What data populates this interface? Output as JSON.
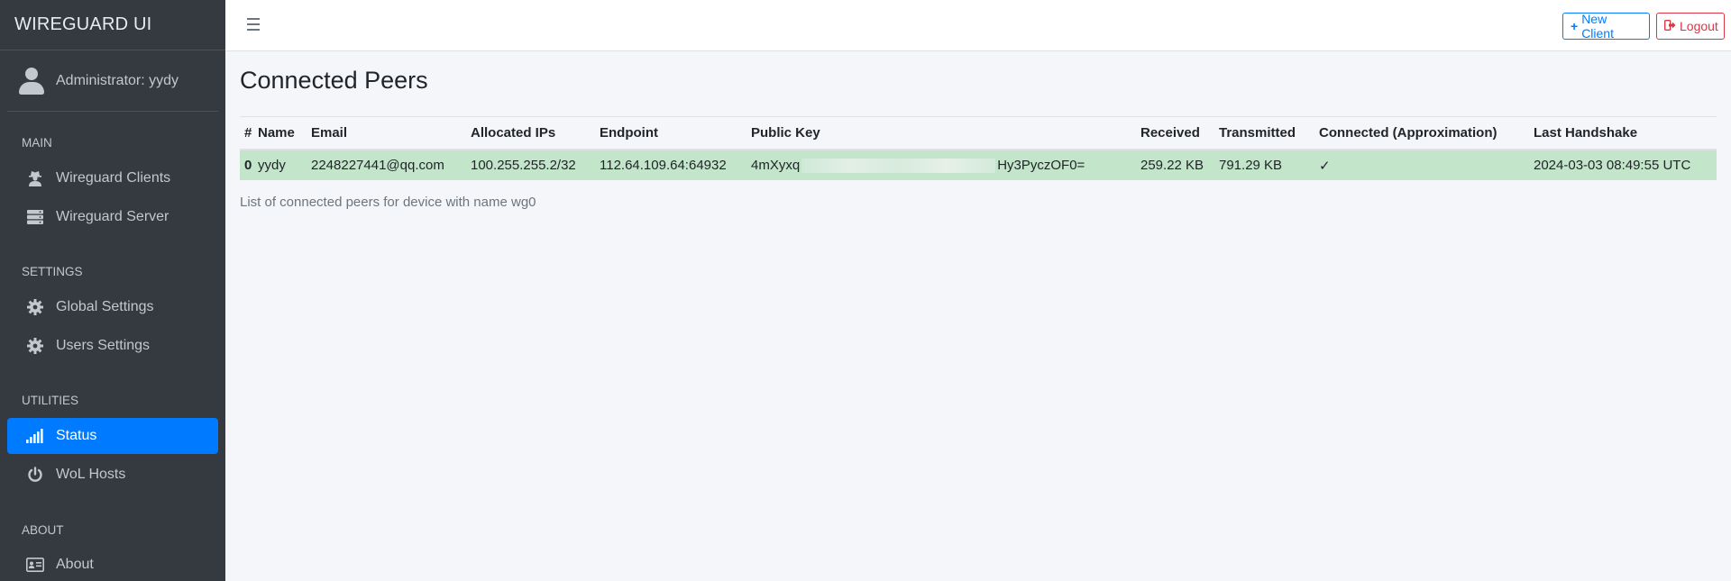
{
  "brand": "WIREGUARD UI",
  "user": {
    "name": "Administrator: yydy"
  },
  "sidebar": {
    "headers": {
      "main": "MAIN",
      "settings": "SETTINGS",
      "utilities": "UTILITIES",
      "about": "ABOUT"
    },
    "items": [
      {
        "label": "Wireguard Clients",
        "icon": "user-secret-icon"
      },
      {
        "label": "Wireguard Server",
        "icon": "server-icon"
      },
      {
        "label": "Global Settings",
        "icon": "gear-icon"
      },
      {
        "label": "Users Settings",
        "icon": "gear-icon"
      },
      {
        "label": "Status",
        "icon": "signal-icon",
        "active": true
      },
      {
        "label": "WoL Hosts",
        "icon": "power-icon"
      },
      {
        "label": "About",
        "icon": "id-card-icon"
      }
    ]
  },
  "toolbar": {
    "new_client": "New Client",
    "logout": "Logout"
  },
  "page": {
    "title": "Connected Peers",
    "caption": "List of connected peers for device with name wg0"
  },
  "table": {
    "headers": [
      "#",
      "Name",
      "Email",
      "Allocated IPs",
      "Endpoint",
      "Public Key",
      "Received",
      "Transmitted",
      "Connected (Approximation)",
      "Last Handshake"
    ],
    "rows": [
      {
        "index": "0",
        "name": "yydy",
        "email": "2248227441@qq.com",
        "allocated_ips": "100.255.255.2/32",
        "endpoint": "112.64.109.64:64932",
        "public_key_start": "4mXyxq",
        "public_key_end": "Hy3PyczOF0=",
        "received": "259.22 KB",
        "transmitted": "791.29 KB",
        "connected": "✓",
        "last_handshake": "2024-03-03 08:49:55 UTC"
      }
    ]
  },
  "colors": {
    "sidebar_bg": "#343a40",
    "accent": "#007bff",
    "danger": "#dc3545",
    "row_success": "#c3e6cb"
  }
}
